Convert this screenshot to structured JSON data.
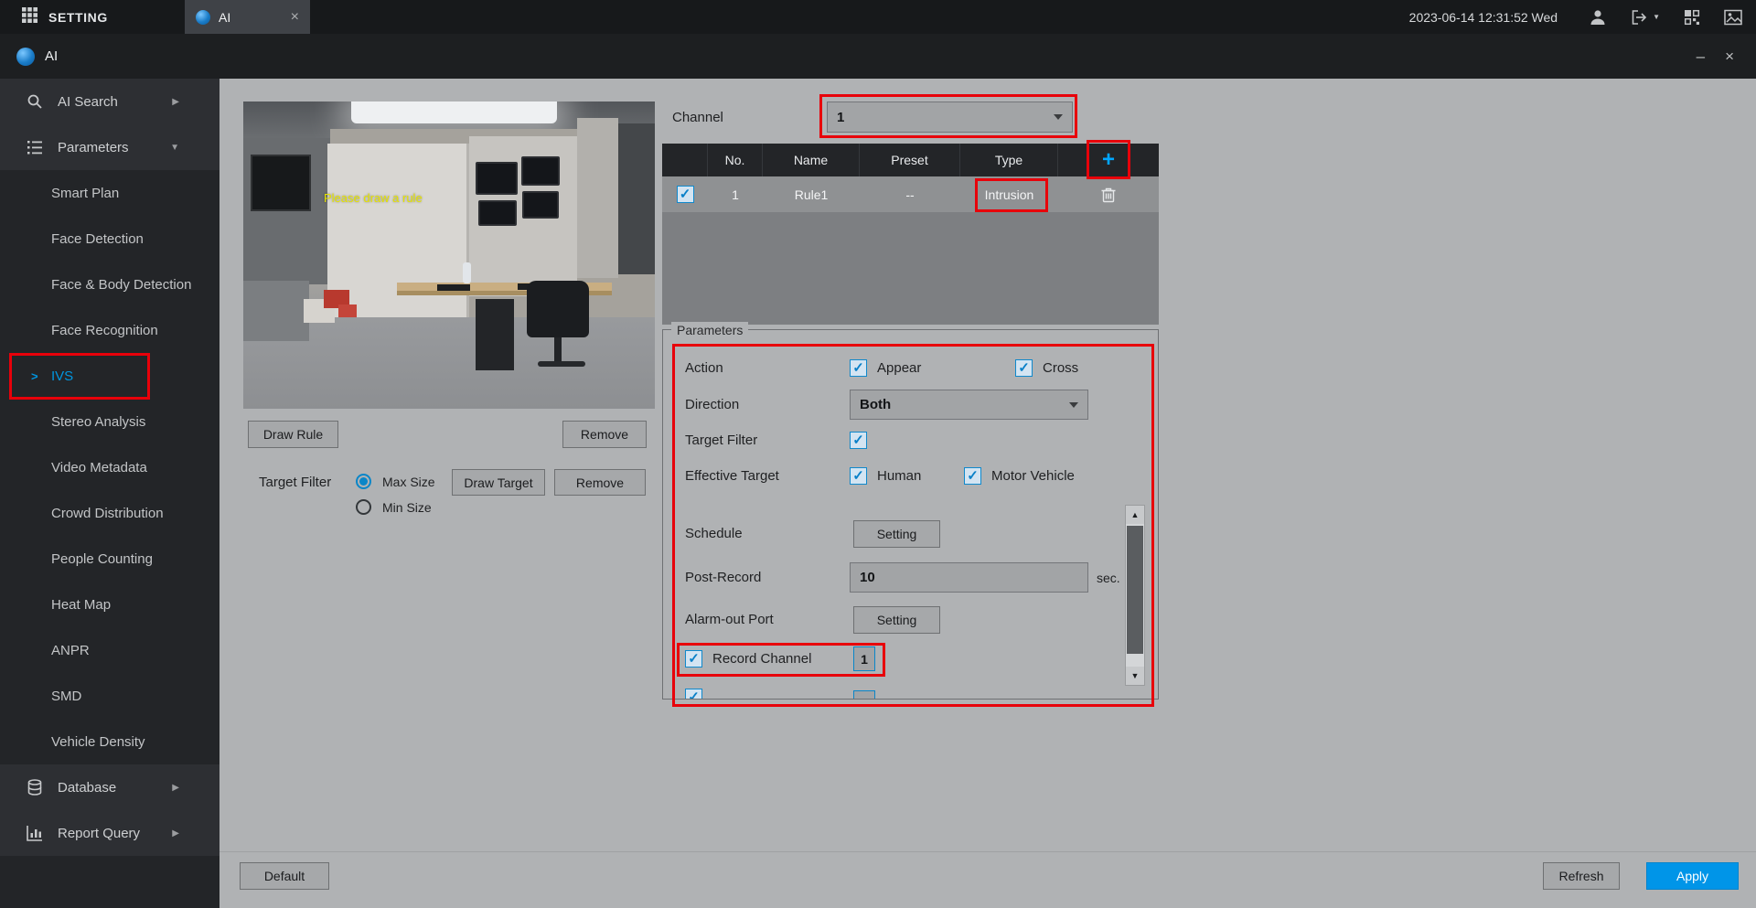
{
  "topbar": {
    "app_title": "SETTING",
    "tab_label": "AI",
    "tab_close": "×",
    "datetime": "2023-06-14 12:31:52 Wed"
  },
  "titlebar": {
    "title": "AI",
    "minimize": "–",
    "close": "×"
  },
  "sidebar": {
    "ai_search": "AI Search",
    "parameters": "Parameters",
    "parameters_items": [
      "Smart Plan",
      "Face Detection",
      "Face & Body Detection",
      "Face Recognition",
      "IVS",
      "Stereo Analysis",
      "Video Metadata",
      "Crowd Distribution",
      "People Counting",
      "Heat Map",
      "ANPR",
      "SMD",
      "Vehicle Density"
    ],
    "active_item": "IVS",
    "database": "Database",
    "report_query": "Report Query"
  },
  "preview": {
    "overlay_text": "Please draw a rule",
    "draw_rule_button": "Draw Rule",
    "remove_button": "Remove",
    "target_filter_label": "Target Filter",
    "max_size_label": "Max Size",
    "min_size_label": "Min Size",
    "draw_target_button": "Draw Target",
    "remove_target_button": "Remove"
  },
  "channel": {
    "label": "Channel",
    "value": "1"
  },
  "rules_table": {
    "headers": {
      "no": "No.",
      "name": "Name",
      "preset": "Preset",
      "type": "Type"
    },
    "add_button": "+",
    "row": {
      "no": "1",
      "name": "Rule1",
      "preset": "--",
      "type": "Intrusion",
      "checked": true
    }
  },
  "parameters_panel": {
    "title": "Parameters",
    "action_label": "Action",
    "appear_label": "Appear",
    "cross_label": "Cross",
    "direction_label": "Direction",
    "direction_value": "Both",
    "target_filter_label": "Target Filter",
    "effective_target_label": "Effective Target",
    "human_label": "Human",
    "motor_vehicle_label": "Motor Vehicle",
    "schedule_label": "Schedule",
    "schedule_button": "Setting",
    "post_record_label": "Post-Record",
    "post_record_value": "10",
    "post_record_unit": "sec.",
    "alarm_out_label": "Alarm-out Port",
    "alarm_out_button": "Setting",
    "record_channel_label": "Record Channel",
    "record_channel_value": "1"
  },
  "footer": {
    "default_button": "Default",
    "refresh_button": "Refresh",
    "apply_button": "Apply"
  },
  "colors": {
    "accent_blue": "#0096e0",
    "annotation_red": "#e8000a",
    "apply_blue": "#0095e8"
  }
}
